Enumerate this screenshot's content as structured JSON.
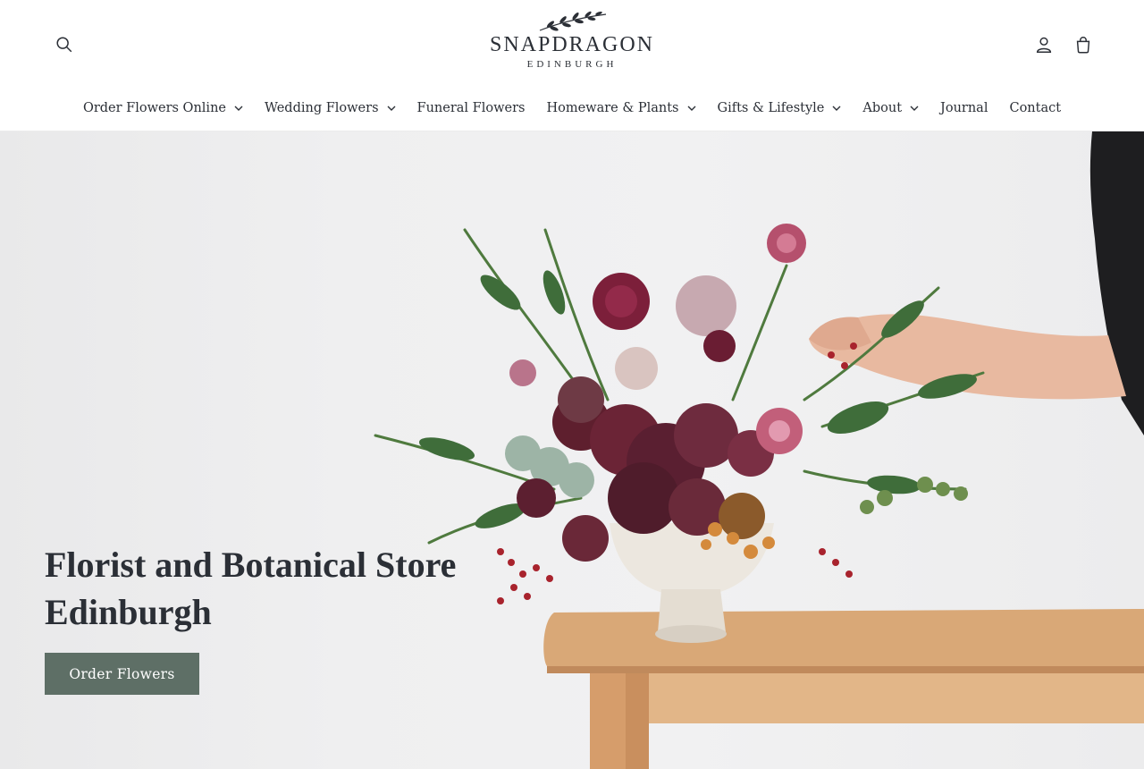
{
  "header": {
    "logo": {
      "name": "SNAPDRAGON",
      "sub": "EDINBURGH"
    },
    "icons": {
      "search": "search-icon",
      "account": "user-icon",
      "cart": "cart-icon"
    }
  },
  "nav": {
    "items": [
      {
        "label": "Order Flowers Online",
        "has_dropdown": true
      },
      {
        "label": "Wedding Flowers",
        "has_dropdown": true
      },
      {
        "label": "Funeral Flowers",
        "has_dropdown": false
      },
      {
        "label": "Homeware & Plants",
        "has_dropdown": true
      },
      {
        "label": "Gifts & Lifestyle",
        "has_dropdown": true
      },
      {
        "label": "About",
        "has_dropdown": true
      },
      {
        "label": "Journal",
        "has_dropdown": false
      },
      {
        "label": "Contact",
        "has_dropdown": false
      }
    ]
  },
  "hero": {
    "title_line1": "Florist and Botanical Store",
    "title_line2": "Edinburgh",
    "cta_label": "Order Flowers"
  },
  "colors": {
    "text": "#2b2f36",
    "cta_bg": "#5e6f66",
    "background": "#ffffff"
  }
}
